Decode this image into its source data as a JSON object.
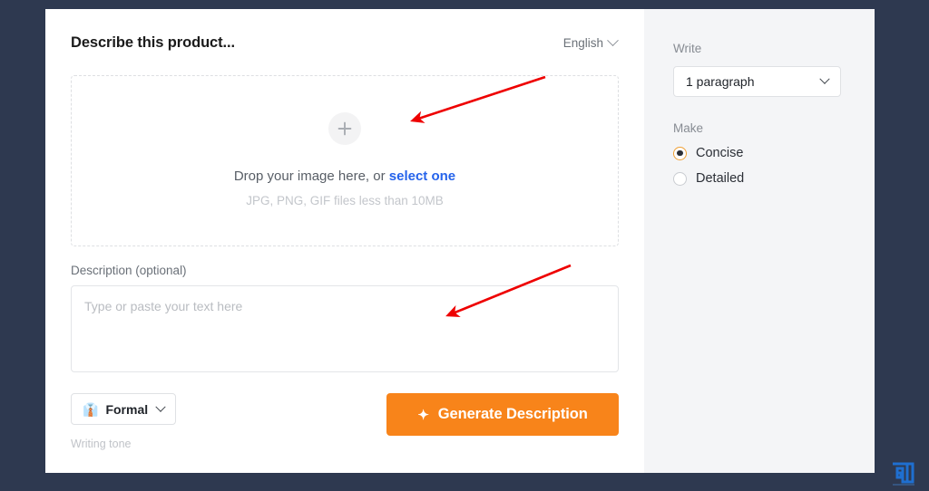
{
  "theme": {
    "page_background": "#2e3950",
    "card_background": "#ffffff",
    "side_panel_background": "#f4f5f7",
    "accent_orange": "#f8841a",
    "radio_accent": "#f0a034",
    "link_blue": "#2563eb",
    "annotation_red": "#ee0000"
  },
  "main": {
    "title": "Describe this product...",
    "language": {
      "value": "English",
      "icon": "chevron-down-icon"
    },
    "dropzone": {
      "plus_icon": "plus-icon",
      "prompt_prefix": "Drop your image here, or ",
      "prompt_link": "select one",
      "hint": "JPG, PNG, GIF files less than 10MB"
    },
    "description": {
      "label": "Description (optional)",
      "placeholder": "Type or paste your text here",
      "value": ""
    },
    "tone": {
      "emoji": "👔",
      "label": "Formal",
      "caption": "Writing tone",
      "icon": "chevron-down-icon"
    },
    "generate": {
      "label": "Generate Description",
      "icon": "sparkles-icon"
    }
  },
  "sidebar": {
    "write": {
      "label": "Write",
      "selected": "1 paragraph",
      "icon": "chevron-down-icon"
    },
    "make": {
      "label": "Make",
      "options": [
        {
          "label": "Concise",
          "checked": true
        },
        {
          "label": "Detailed",
          "checked": false
        }
      ]
    }
  },
  "annotations": {
    "arrow_one_target": "dropzone",
    "arrow_two_target": "description-textarea"
  },
  "watermark": {
    "text": "G1"
  }
}
